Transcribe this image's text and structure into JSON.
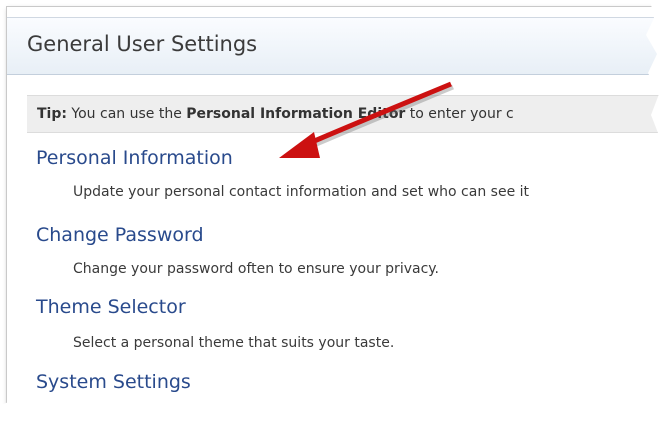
{
  "panel": {
    "title": "General User Settings"
  },
  "tip": {
    "label": "Tip:",
    "text_before": "You can use the",
    "highlight": "Personal Information Editor",
    "text_after": "to enter your c"
  },
  "settings": [
    {
      "label": "Personal Information",
      "description": "Update your personal contact information and set who can see it"
    },
    {
      "label": "Change Password",
      "description": "Change your password often to ensure your privacy."
    },
    {
      "label": "Theme Selector",
      "description": "Select a personal theme that suits your taste."
    },
    {
      "label": "System Settings",
      "description": ""
    }
  ],
  "annotation": {
    "arrow_color": "#cc1111",
    "icon": "red-arrow-annotation"
  }
}
